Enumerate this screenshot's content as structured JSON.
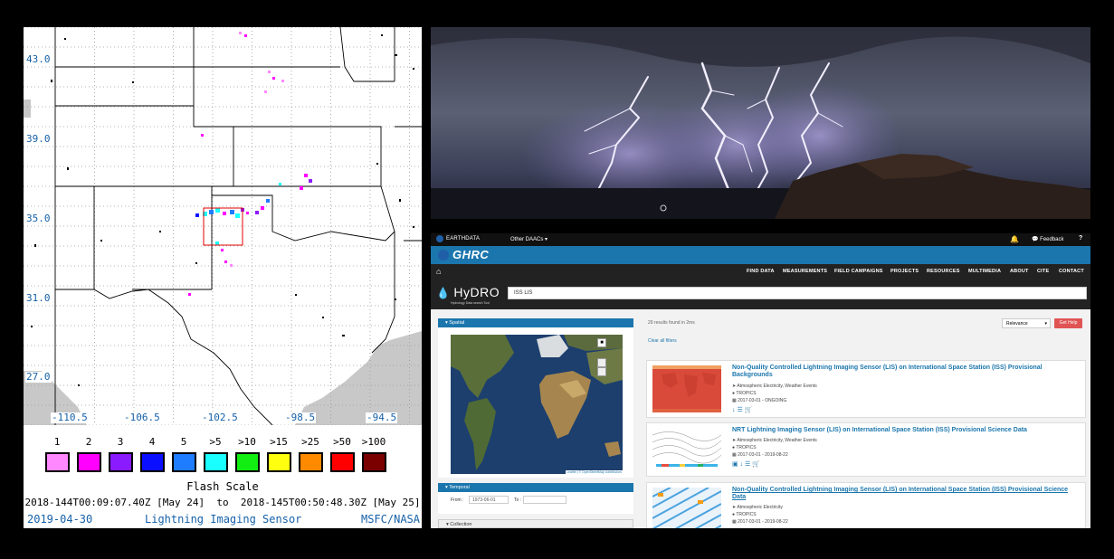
{
  "lightning_map": {
    "lat_labels": [
      "43.0",
      "39.0",
      "35.0",
      "31.0",
      "27.0"
    ],
    "lon_labels": [
      "-110.5",
      "-106.5",
      "-102.5",
      "-98.5",
      "-94.5"
    ],
    "flash_scale": {
      "title": "Flash Scale",
      "levels": [
        {
          "label": "1",
          "color": "#ff88ff"
        },
        {
          "label": "2",
          "color": "#ff00ff"
        },
        {
          "label": "3",
          "color": "#8a1bff"
        },
        {
          "label": "4",
          "color": "#0a10ff"
        },
        {
          "label": "5",
          "color": "#1e7cff"
        },
        {
          "label": ">5",
          "color": "#19ffff"
        },
        {
          "label": ">10",
          "color": "#12ee12"
        },
        {
          "label": ">15",
          "color": "#ffff10"
        },
        {
          "label": ">25",
          "color": "#ff8a00"
        },
        {
          "label": ">50",
          "color": "#ff0000"
        },
        {
          "label": ">100",
          "color": "#7a0000"
        }
      ]
    },
    "time_range": "2018-144T00:09:07.40Z [May 24]  to  2018-145T00:50:48.30Z [May 25]",
    "footer": {
      "date": "2019-04-30",
      "sensor": "Lightning Imaging Sensor",
      "org": "MSFC/NASA"
    }
  },
  "site": {
    "topbar": {
      "logo_text": "EARTHDATA",
      "other_daacs": "Other DAACs ▾",
      "feedback": "Feedback",
      "help": "?"
    },
    "brand": "GHRC",
    "nav": [
      "FIND DATA",
      "MEASUREMENTS",
      "FIELD CAMPAIGNS",
      "PROJECTS",
      "RESOURCES",
      "MULTIMEDIA",
      "ABOUT",
      "CITE",
      "CONTACT"
    ],
    "hydro": {
      "title": "HyDRO",
      "subtitle": "Hydrology Data search Tool"
    },
    "search": {
      "value": "ISS LIS"
    },
    "facets": {
      "spatial": "Spatial",
      "temporal": "Temporal",
      "from_label": "From :",
      "from_value": "1973-06-01",
      "to_label": "To :",
      "to_value": "",
      "collection": "Collection",
      "map_credit": "Leaflet | © OpenStreetMap contributors"
    },
    "results": {
      "count_text": "29 results found in 2ms",
      "clear_filters": "Clear all filters",
      "sort_value": "Relevance",
      "help_button": "Get Help",
      "items": [
        {
          "title": "Non-Quality Controlled Lightning Imaging Sensor (LIS) on International Space Station (ISS) Provisional Backgrounds",
          "keywords": "Atmospheric Electricity, Weather Events",
          "platform": "TROPICS",
          "dates": "2017-03-01 - ONGOING"
        },
        {
          "title": "NRT Lightning Imaging Sensor (LIS) on International Space Station (ISS) Provisional Science Data",
          "keywords": "Atmospheric Electricity, Weather Events",
          "platform": "TROPICS",
          "dates": "2017-03-01 - 2019-08-22"
        },
        {
          "title": "Non-Quality Controlled Lightning Imaging Sensor (LIS) on International Space Station (ISS) Provisional Science Data",
          "keywords": "Atmospheric Electricity",
          "platform": "TROPICS",
          "dates": "2017-03-01 - 2019-08-22"
        }
      ]
    }
  }
}
